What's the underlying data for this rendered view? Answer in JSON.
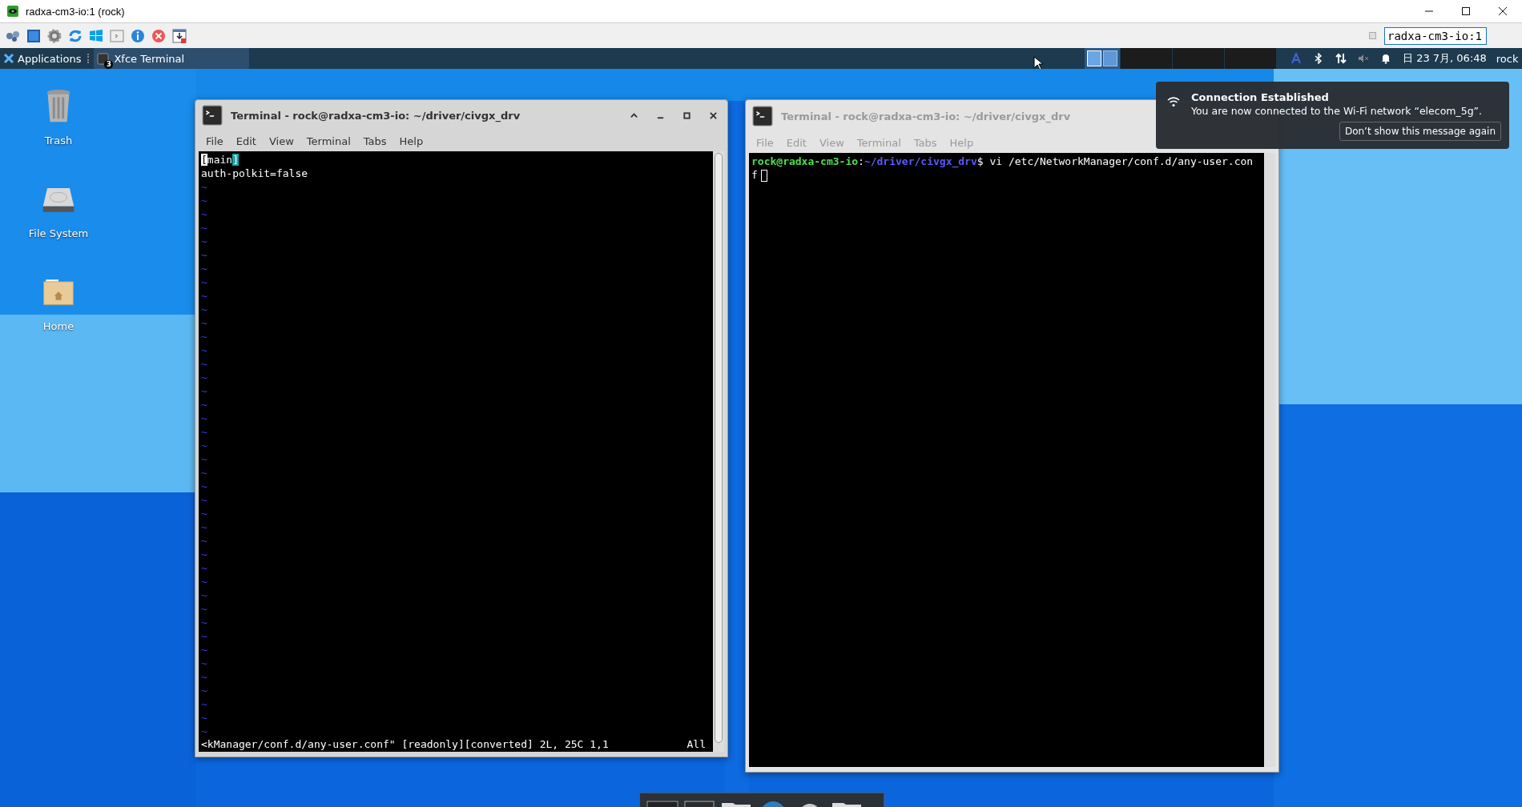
{
  "viewer": {
    "title": "radxa-cm3-io:1 (rock)",
    "host_field": "radxa-cm3-io:1"
  },
  "panel": {
    "applications": "Applications",
    "task": {
      "label": "Xfce Terminal",
      "badge": "3"
    },
    "workspaces": [
      {
        "selected": true
      },
      {
        "selected": false
      }
    ],
    "clock": "日 23 7月, 06:48",
    "user": "rock"
  },
  "desktop_icons": [
    {
      "kind": "trash",
      "label": "Trash"
    },
    {
      "kind": "drive",
      "label": "File System"
    },
    {
      "kind": "home",
      "label": "Home"
    }
  ],
  "terminals": [
    {
      "title": "Terminal - rock@radxa-cm3-io: ~/driver/civgx_drv",
      "active": true,
      "menu": [
        "File",
        "Edit",
        "View",
        "Terminal",
        "Tabs",
        "Help"
      ],
      "lines": [
        [
          {
            "text": "[",
            "kind": "cursor"
          },
          {
            "text": "main",
            "kind": "text"
          },
          {
            "text": "]",
            "kind": "match"
          }
        ],
        [
          {
            "text": "auth-polkit=false",
            "kind": "text"
          }
        ]
      ],
      "tildes": [
        "~",
        "~",
        "~",
        "~",
        "~",
        "~",
        "~",
        "~",
        "~",
        "~",
        "~",
        "~",
        "~",
        "~",
        "~",
        "~",
        "~",
        "~",
        "~",
        "~",
        "~",
        "~",
        "~",
        "~",
        "~",
        "~",
        "~",
        "~",
        "~",
        "~",
        "~",
        "~",
        "~",
        "~",
        "~",
        "~",
        "~",
        "~",
        "~",
        "~",
        "~"
      ],
      "status": {
        "message": "<kManager/conf.d/any-user.conf\" [readonly][converted] 2L, 25C 1,1",
        "position": "All"
      }
    },
    {
      "title": "Terminal - rock@radxa-cm3-io: ~/driver/civgx_drv",
      "active": false,
      "menu": [
        "File",
        "Edit",
        "View",
        "Terminal",
        "Tabs",
        "Help"
      ],
      "lines": [
        [
          {
            "text": "rock@radxa-cm3-io",
            "kind": "user"
          },
          {
            "text": ":",
            "kind": "text"
          },
          {
            "text": "~/driver/civgx_drv",
            "kind": "path"
          },
          {
            "text": "$ vi /etc/NetworkManager/conf.d/any-user.con",
            "kind": "text"
          }
        ],
        [
          {
            "text": "f",
            "kind": "text"
          }
        ]
      ]
    }
  ],
  "notification": {
    "title": "Connection Established",
    "body": "You are now connected to the Wi-Fi network “elecom_5g”.",
    "button": "Don’t show this message again"
  }
}
